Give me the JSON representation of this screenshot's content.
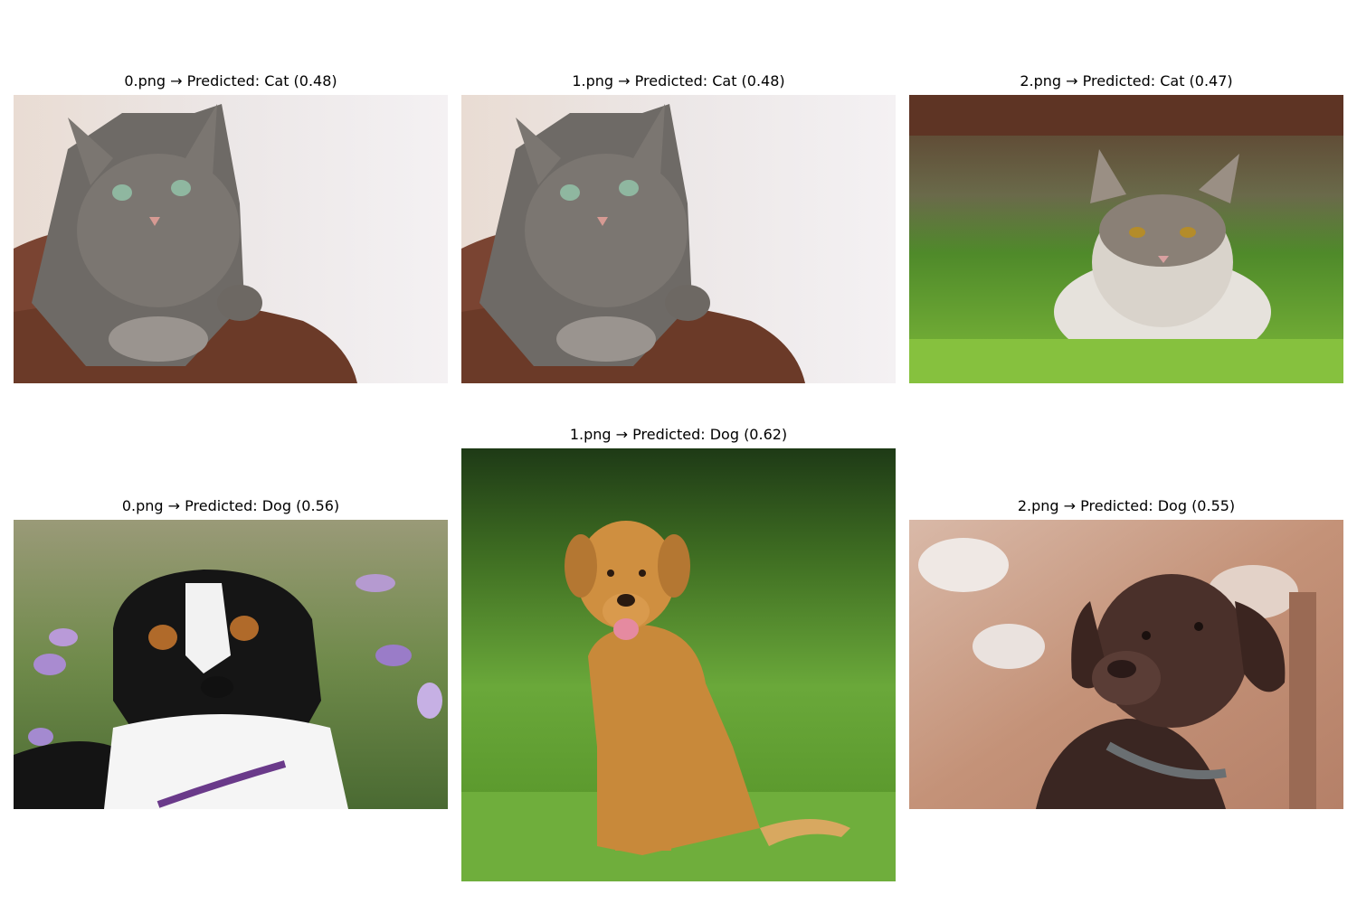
{
  "panels": [
    {
      "caption": "0.png → Predicted: Cat (0.48)",
      "subject": "tabby-cat-photo"
    },
    {
      "caption": "1.png → Predicted: Cat (0.48)",
      "subject": "tabby-cat-photo"
    },
    {
      "caption": "2.png → Predicted: Cat (0.47)",
      "subject": "white-cat-in-grass-photo"
    },
    {
      "caption": "0.png → Predicted: Dog (0.56)",
      "subject": "tricolor-dog-in-flowers-photo"
    },
    {
      "caption": "1.png → Predicted: Dog (0.62)",
      "subject": "golden-retriever-on-grass-photo"
    },
    {
      "caption": "2.png → Predicted: Dog (0.55)",
      "subject": "chocolate-labrador-photo"
    }
  ]
}
